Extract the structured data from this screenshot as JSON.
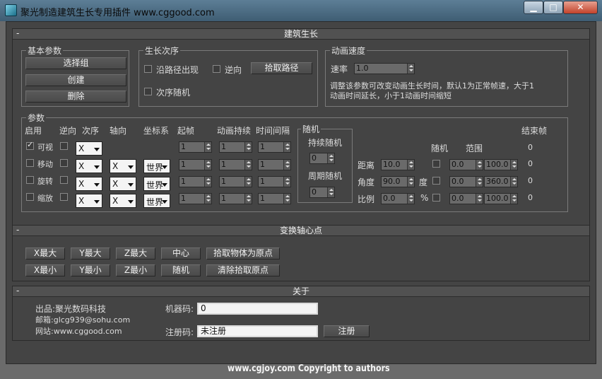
{
  "window": {
    "title": "聚光制造建筑生长专用插件 www.cggood.com",
    "min": "▁",
    "max": "□",
    "close": "✕"
  },
  "rollout_growth": {
    "title": "建筑生长",
    "basic": {
      "title": "基本参数",
      "select_group": "选择组",
      "create": "创建",
      "delete": "删除"
    },
    "order": {
      "title": "生长次序",
      "along_path": "沿路径出现",
      "reverse": "逆向",
      "pick_path": "拾取路径",
      "random_order": "次序随机"
    },
    "speed": {
      "title": "动画速度",
      "rate_label": "速率",
      "rate_value": "1.0",
      "hint_line1": "调整该参数可改变动画生长时间，默认1为正常帧速，大于1",
      "hint_line2": "动画时间延长，小于1动画时间缩短"
    },
    "params": {
      "title": "参数",
      "headers": {
        "enable": "启用",
        "reverse": "逆向",
        "order": "次序",
        "axis": "轴向",
        "coord": "坐标系",
        "start": "起帧",
        "duration": "动画持续",
        "interval": "时间间隔",
        "end": "结束帧"
      },
      "rows": [
        {
          "name": "可视",
          "enabled": true,
          "order": "X",
          "axis": "",
          "coord": "",
          "start": "1",
          "duration": "1",
          "interval": "1"
        },
        {
          "name": "移动",
          "enabled": false,
          "order": "X",
          "axis": "X",
          "coord": "世界",
          "start": "1",
          "duration": "1",
          "interval": "1"
        },
        {
          "name": "旋转",
          "enabled": false,
          "order": "X",
          "axis": "X",
          "coord": "世界",
          "start": "1",
          "duration": "1",
          "interval": "1"
        },
        {
          "name": "缩放",
          "enabled": false,
          "order": "X",
          "axis": "X",
          "coord": "世界",
          "start": "1",
          "duration": "1",
          "interval": "1"
        }
      ],
      "random": {
        "title": "随机",
        "continuous": "持续随机",
        "continuous_value": "0",
        "periodic": "周期随机",
        "periodic_value": "0"
      },
      "rand_header": {
        "random": "随机",
        "range": "范围"
      },
      "measures": [
        {
          "label": "距离",
          "value": "10.0",
          "unit": "",
          "lo": "0.0",
          "hi": "100.0",
          "end": "0"
        },
        {
          "label": "角度",
          "value": "90.0",
          "unit": "度",
          "lo": "0.0",
          "hi": "360.0",
          "end": "0"
        },
        {
          "label": "比例",
          "value": "0.0",
          "unit": "%",
          "lo": "0.0",
          "hi": "100.0",
          "end": "0"
        }
      ],
      "end_first": "0"
    }
  },
  "rollout_pivot": {
    "title": "变换轴心点",
    "buttons": [
      "X最大",
      "Y最大",
      "Z最大",
      "中心",
      "拾取物体为原点",
      "X最小",
      "Y最小",
      "Z最小",
      "随机",
      "清除拾取原点"
    ]
  },
  "rollout_about": {
    "title": "关于",
    "publisher": "出品:聚光数码科技",
    "email": "邮箱:glcg939@sohu.com",
    "website": "网站:www.cggood.com",
    "machine_label": "机器码:",
    "machine_value": "0",
    "reg_label": "注册码:",
    "reg_value": "未注册",
    "register_btn": "注册"
  },
  "watermark": "www.cgjoy.com Copyright to authors"
}
